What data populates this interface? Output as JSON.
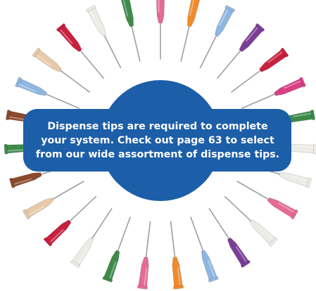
{
  "callout": {
    "lines": [
      "Dispense tips are required to complete",
      "your system. Check out page 63 to select",
      "from our wide assortment of dispense tips."
    ]
  },
  "colors": {
    "badge": "#1d5ea8",
    "text": "#ffffff",
    "needle": "#9aa0a6"
  },
  "tips": [
    {
      "name": "pink",
      "color": "#e46b94"
    },
    {
      "name": "orange",
      "color": "#ef8a2d"
    },
    {
      "name": "light-blue",
      "color": "#8fb6e0"
    },
    {
      "name": "purple",
      "color": "#7b3d96"
    },
    {
      "name": "red",
      "color": "#c8203f"
    },
    {
      "name": "magenta",
      "color": "#d83f86"
    },
    {
      "name": "green",
      "color": "#3e8a4b"
    },
    {
      "name": "white",
      "color": "#ecebe6"
    },
    {
      "name": "white",
      "color": "#ecebe6"
    },
    {
      "name": "pink",
      "color": "#e46b94"
    },
    {
      "name": "white",
      "color": "#ecebe6"
    },
    {
      "name": "purple",
      "color": "#7b3d96"
    },
    {
      "name": "light-blue",
      "color": "#8fb6e0"
    },
    {
      "name": "orange",
      "color": "#ef8a2d"
    },
    {
      "name": "pink",
      "color": "#e46b94"
    },
    {
      "name": "green",
      "color": "#3e8a4b"
    },
    {
      "name": "white",
      "color": "#ecebe6"
    },
    {
      "name": "red",
      "color": "#c8203f"
    },
    {
      "name": "tan",
      "color": "#e8c9a8"
    },
    {
      "name": "brown",
      "color": "#8b4a2c"
    },
    {
      "name": "green",
      "color": "#3e8a4b"
    },
    {
      "name": "brown",
      "color": "#8b4a2c"
    },
    {
      "name": "light-blue",
      "color": "#8fb6e0"
    },
    {
      "name": "tan",
      "color": "#e8c9a8"
    },
    {
      "name": "red",
      "color": "#c8203f"
    },
    {
      "name": "white",
      "color": "#ecebe6"
    },
    {
      "name": "green",
      "color": "#3e8a4b"
    }
  ]
}
